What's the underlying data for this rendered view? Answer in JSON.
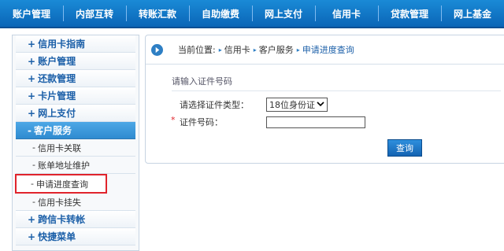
{
  "topnav": [
    "账户管理",
    "内部互转",
    "转账汇款",
    "自助缴费",
    "网上支付",
    "信用卡",
    "贷款管理",
    "网上基金"
  ],
  "sidebar": {
    "items_top": [
      {
        "label": "信用卡指南",
        "prefix": "+"
      },
      {
        "label": "账户管理",
        "prefix": "+"
      },
      {
        "label": "还款管理",
        "prefix": "+"
      },
      {
        "label": "卡片管理",
        "prefix": "+"
      },
      {
        "label": "网上支付",
        "prefix": "+"
      }
    ],
    "group": {
      "label": "客户服务",
      "prefix": "-"
    },
    "sub_items": [
      {
        "label": "信用卡关联"
      },
      {
        "label": "账单地址维护"
      },
      {
        "label": "申请进度查询"
      },
      {
        "label": "信用卡挂失"
      }
    ],
    "items_bottom": [
      {
        "label": "跨信卡转帐",
        "prefix": "+"
      },
      {
        "label": "快捷菜单",
        "prefix": "+"
      }
    ]
  },
  "breadcrumb": {
    "prefix": "当前位置:",
    "crumbs": [
      "信用卡",
      "客户服务",
      "申请进度查询"
    ]
  },
  "form": {
    "section_title": "请输入证件号码",
    "id_type_label": "请选择证件类型：",
    "id_type_value": "18位身份证",
    "id_number_label": "证件号码：",
    "id_number_value": "",
    "required_mark": "*",
    "submit_label": "查询"
  }
}
